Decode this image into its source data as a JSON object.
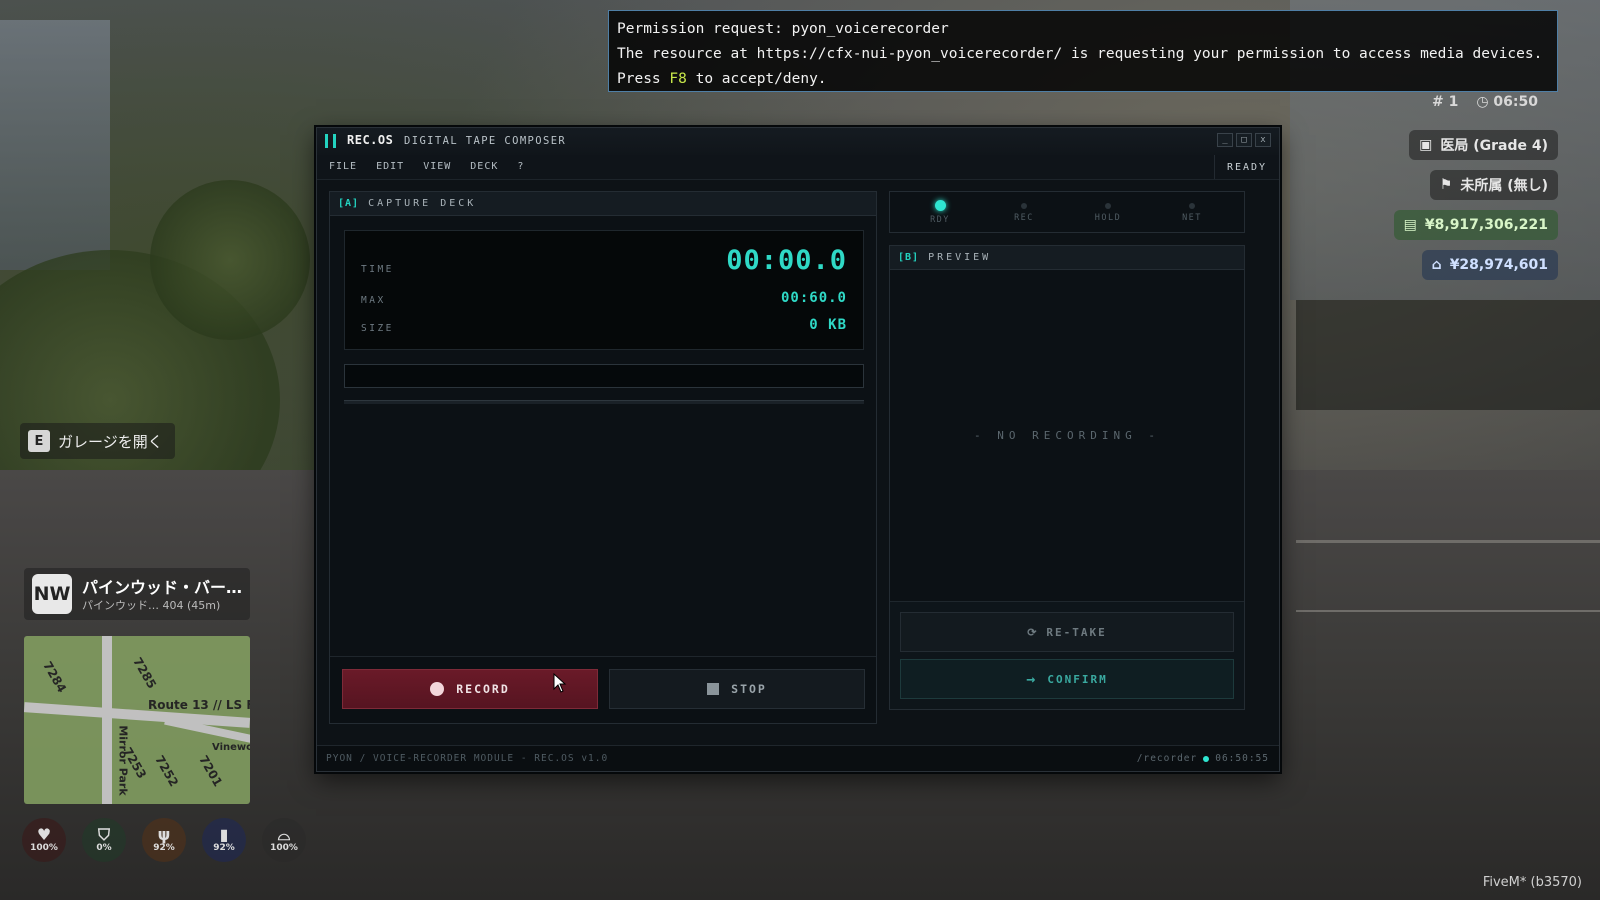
{
  "permission": {
    "line1": "Permission request: pyon_voicerecorder",
    "line2": "The resource at https://cfx-nui-pyon_voicerecorder/ is requesting your permission to access media devices.",
    "line3_pre": "Press ",
    "line3_key": "F8",
    "line3_post": " to accept/deny."
  },
  "hud": {
    "player_id": "# 1",
    "time": "06:50",
    "job": "医局 (Grade 4)",
    "gang": "未所属 (無し)",
    "cash": "¥8,917,306,221",
    "bank": "¥28,974,601",
    "garage_key": "E",
    "garage_label": "ガレージを開く",
    "street_badge": "NW",
    "street_name": "パインウッド・バー…",
    "street_sub": "パインウッド… 404 (45m)",
    "map_labels": [
      "Route 13 // LS Fr",
      "Mirror Park",
      "7284",
      "7285",
      "7253",
      "7252",
      "7201",
      "Vinewo"
    ],
    "stats": [
      {
        "icon": "heart-icon",
        "value": "100%"
      },
      {
        "icon": "shield-icon",
        "value": "0%"
      },
      {
        "icon": "food-icon",
        "value": "92%"
      },
      {
        "icon": "drink-icon",
        "value": "92%"
      },
      {
        "icon": "lungs-icon",
        "value": "100%"
      }
    ],
    "fivem": "FiveM* (b3570)"
  },
  "window": {
    "brand": "REC.OS",
    "subtitle": "DIGITAL TAPE COMPOSER",
    "controls": [
      "_",
      "□",
      "x"
    ],
    "menu": [
      "FILE",
      "EDIT",
      "VIEW",
      "DECK",
      "?"
    ],
    "status_word": "READY"
  },
  "deck": {
    "tag": "[A]",
    "title": "CAPTURE DECK",
    "time_label": "TIME",
    "time_value": "00:00.0",
    "max_label": "MAX",
    "max_value": "00:60.0",
    "size_label": "SIZE",
    "size_value": "0 KB",
    "record_label": "RECORD",
    "stop_label": "STOP"
  },
  "status_leds": [
    {
      "label": "RDY",
      "active": true
    },
    {
      "label": "REC",
      "active": false
    },
    {
      "label": "HOLD",
      "active": false
    },
    {
      "label": "NET",
      "active": false
    }
  ],
  "preview": {
    "tag": "[B]",
    "title": "PREVIEW",
    "empty": "- NO RECORDING -",
    "retake_label": "RE-TAKE",
    "confirm_label": "CONFIRM"
  },
  "footer": {
    "left": "PYON / VOICE-RECORDER MODULE - REC.OS v1.0",
    "cmd": "/recorder",
    "clock": "06:50:55"
  },
  "colors": {
    "accent": "#2fd9c6",
    "record": "#6a1a28",
    "window_bg": "#0d1216"
  }
}
